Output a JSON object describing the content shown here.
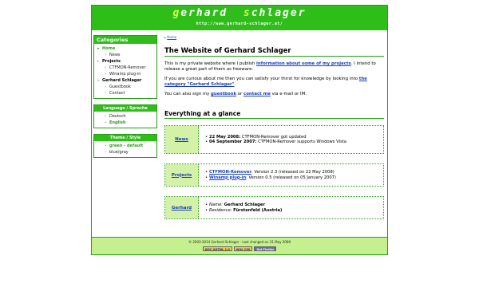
{
  "header": {
    "title_parts": [
      {
        "cap": "g",
        "rest": "erhard"
      },
      {
        "cap": "s",
        "rest": "chlager"
      }
    ],
    "url": "http://www.gerhard-schlager.at/"
  },
  "sidebar": {
    "categories": {
      "heading": "Categories",
      "items": [
        {
          "label": "Home",
          "level": 0,
          "state": "active"
        },
        {
          "label": "News",
          "level": 1
        },
        {
          "label": "Projects",
          "level": 0,
          "state": "strong"
        },
        {
          "label": "CTFMON-Remover",
          "level": 1
        },
        {
          "label": "Winamp plug-in",
          "level": 1
        },
        {
          "label": "Gerhard Schlager",
          "level": 0,
          "state": "strong"
        },
        {
          "label": "Guestbook",
          "level": 1
        },
        {
          "label": "Contact",
          "level": 1
        }
      ]
    },
    "language": {
      "heading": "Language / Sprache",
      "items": [
        {
          "label": "Deutsch",
          "state": ""
        },
        {
          "label": "English",
          "state": "active"
        }
      ]
    },
    "theme": {
      "heading": "Theme / Style",
      "items": [
        {
          "label": "green - default",
          "state": "active"
        },
        {
          "label": "blue/gray",
          "state": ""
        }
      ]
    }
  },
  "content": {
    "breadcrumb": "Home",
    "title": "The Website of Gerhard Schlager",
    "p1": {
      "before": "This is my private website where I publish ",
      "link": "information about some of my projects",
      "after": ". I intend to release a great part of them as freeware."
    },
    "p2": {
      "before": "If you are curious about me then you can satisfy your thirst for knowledge by looking into ",
      "link": "the category \"Gerhard Schlager\"",
      "after": "."
    },
    "p3": {
      "before": "You can also sign my ",
      "link1": "guestbook",
      "mid": " or ",
      "link2": "contact me",
      "after": " via e-mail or IM."
    },
    "glance_title": "Everything at a glance",
    "glance": {
      "news": {
        "label": "News",
        "items": [
          {
            "date": "22 May 2008:",
            "text": " CTFMON-Remover got updated"
          },
          {
            "date": "04 September 2007:",
            "text": " CTFMON-Remover supports Windows Vista"
          }
        ]
      },
      "projects": {
        "label": "Projects",
        "items": [
          {
            "link": "CTFMON-Remover",
            "text": ": Version 2.3 (released on 22 May 2008)"
          },
          {
            "link": "Winamp plug-in",
            "text": ": Version 0.5 (released on 05 January 2007)"
          }
        ]
      },
      "gerhard": {
        "label": "Gerhard",
        "items": [
          {
            "key": "Name:",
            "value": "Gerhard Schlager"
          },
          {
            "key": "Residence:",
            "value": "Fürstenfeld (Austria)"
          }
        ]
      }
    }
  },
  "footer": {
    "text": "© 2003-2014 Gerhard Schlager - Last changed on 31 May 2008",
    "badges": [
      "W3C XHTML 1.0",
      "W3C CSS",
      "Get Firefox"
    ]
  },
  "colors": {
    "accent": "#2fbd1a",
    "border": "#2a9d18",
    "cell_bg": "#d3f2a8",
    "footer_bg": "#c4f08f",
    "link": "#1a3fb8"
  }
}
